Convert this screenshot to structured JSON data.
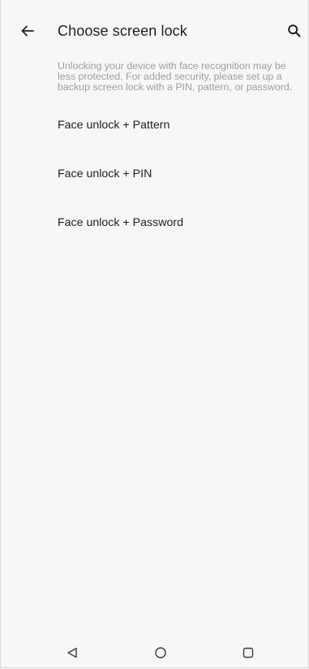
{
  "header": {
    "title": "Choose screen lock",
    "back_icon": "arrow-left-icon",
    "search_icon": "search-icon"
  },
  "description": "Unlocking your device with face recognition may be less protected. For added security, please set up a backup screen lock with a PIN, pattern, or password.",
  "options": [
    {
      "label": "Face unlock + Pattern"
    },
    {
      "label": "Face unlock + PIN"
    },
    {
      "label": "Face unlock + Password"
    }
  ],
  "navigation": {
    "back_icon": "triangle-back-icon",
    "home_icon": "circle-home-icon",
    "recents_icon": "square-recents-icon"
  },
  "colors": {
    "background": "#f7f7f7",
    "text_primary": "#1f1f1f",
    "text_secondary": "#9e9e9e"
  }
}
